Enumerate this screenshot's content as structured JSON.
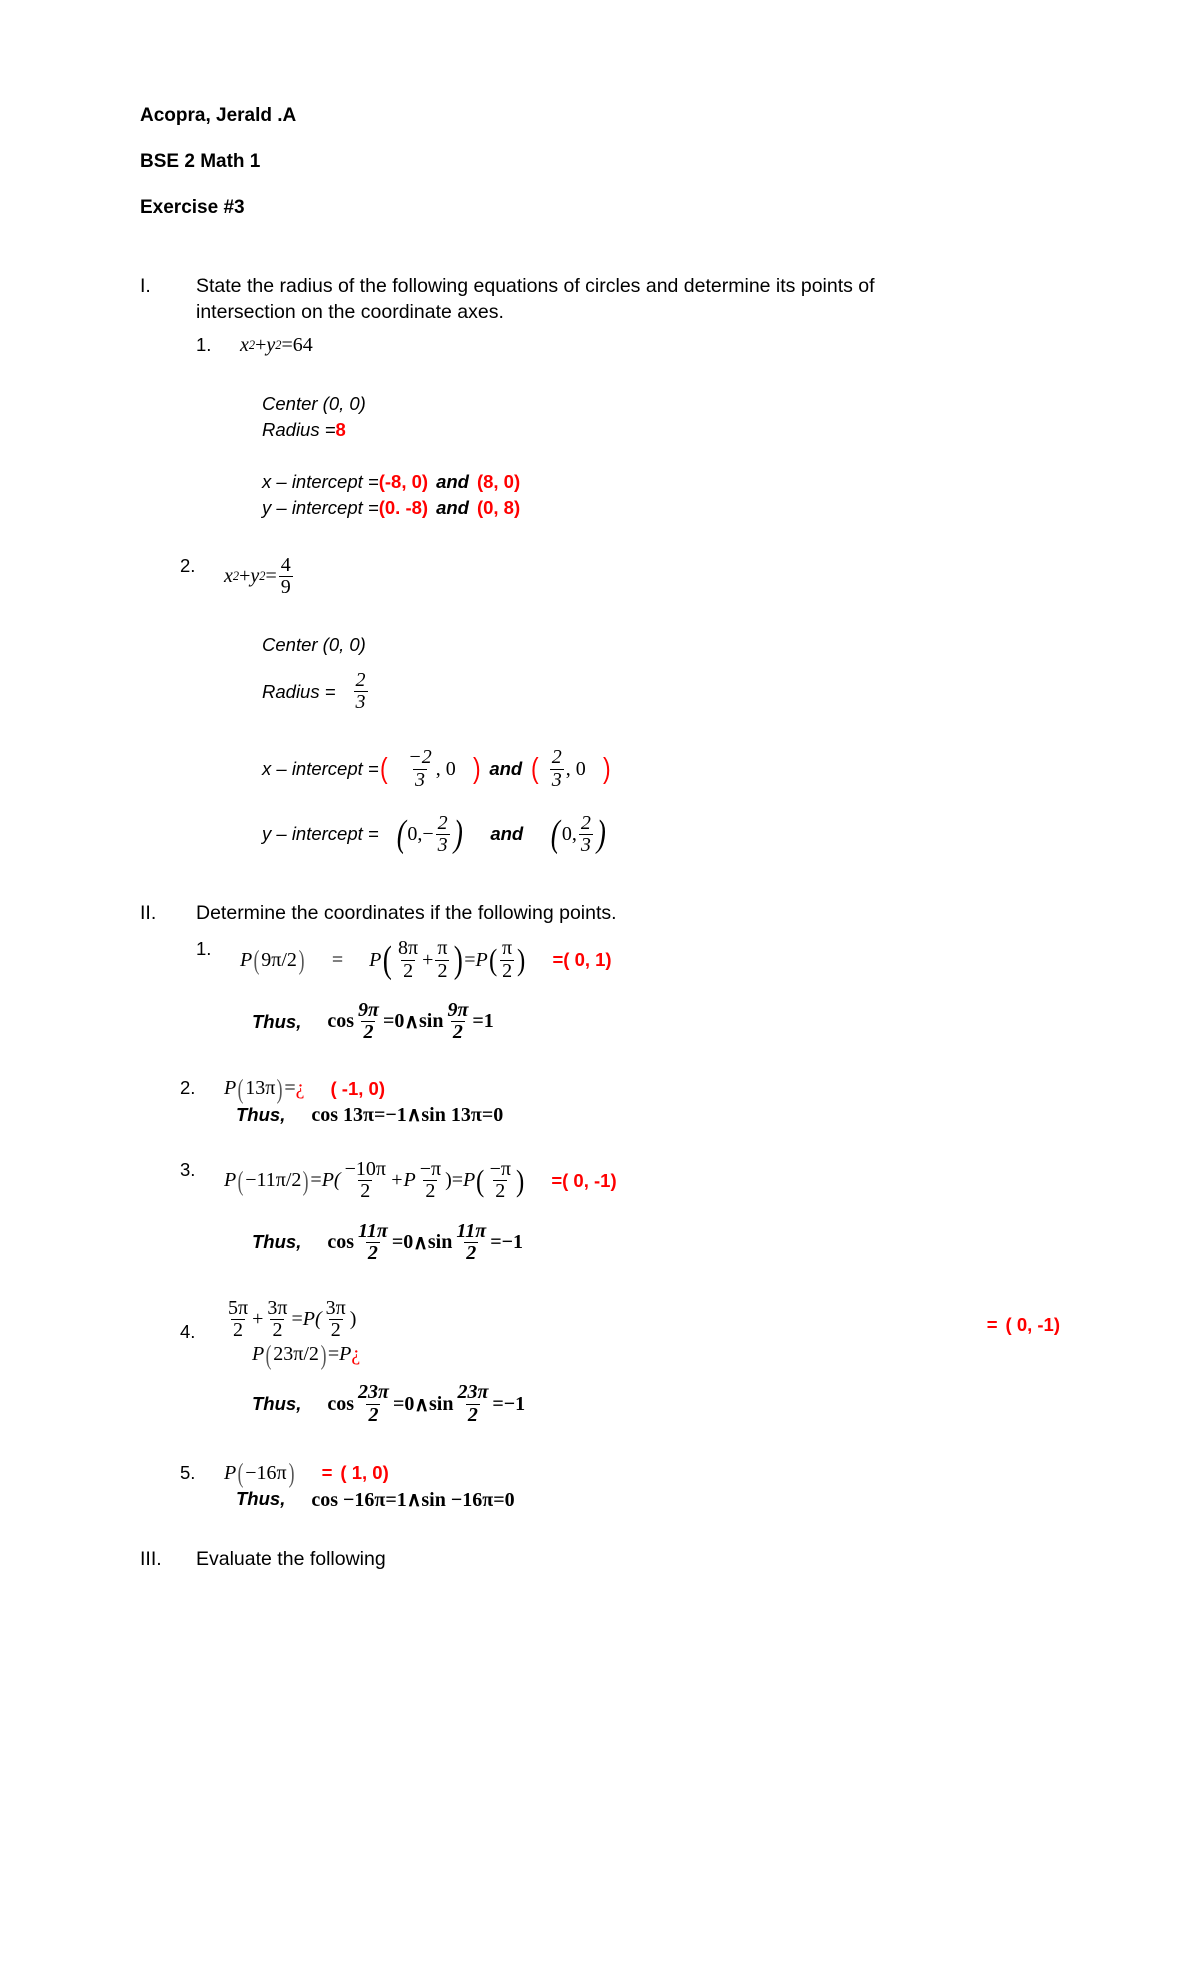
{
  "document": {
    "header": {
      "name": "Acopra, Jerald .A",
      "course": "BSE 2 Math 1",
      "exercise": "Exercise #3"
    },
    "sections": [
      {
        "numeral": "I.",
        "instruction": "State the radius of the following equations of circles and determine its points of intersection on the coordinate axes."
      },
      {
        "numeral": "II.",
        "instruction": "Determine the coordinates if the following points."
      },
      {
        "numeral": "III.",
        "instruction": "Evaluate the following"
      }
    ],
    "section1": {
      "item1": {
        "number": "1.",
        "equation": {
          "x": "x",
          "xsup": "2",
          "plus": "+",
          "y": "y",
          "ysup": "2",
          "eq": "=",
          "rhs": "64"
        },
        "center_label": "Center (0, 0)",
        "radius_label": "Radius = ",
        "radius_value": "8",
        "x_intercept_label": "x – intercept = ",
        "x_intercept_a": "(-8, 0)",
        "x_intercept_and": "and",
        "x_intercept_b": "(8, 0)",
        "y_intercept_label": "y – intercept = ",
        "y_intercept_a": "(0. -8)",
        "y_intercept_and": "and",
        "y_intercept_b": "(0, 8)"
      },
      "item2": {
        "number": "2.",
        "equation": {
          "x": "x",
          "xsup": "2",
          "plus": "+",
          "y": "y",
          "ysup": "2",
          "eq": "=",
          "rhs_num": "4",
          "rhs_den": "9"
        },
        "center_label": "Center (0, 0)",
        "radius_label": "Radius = ",
        "radius_num": "2",
        "radius_den": "3",
        "x_intercept_label": "x – intercept = ",
        "x_paren_open": "(",
        "x_a_num": "−2",
        "x_a_den": "3",
        "x_a_zero": ", 0",
        "x_paren_close": ")",
        "x_and": "and",
        "x_paren_open2": "(",
        "x_b_num": "2",
        "x_b_den": "3",
        "x_b_zero": ", 0",
        "x_paren_close2": ")",
        "y_intercept_label": "y – intercept = ",
        "y_a_open": "(",
        "y_a_zero": "0,−",
        "y_a_num": "2",
        "y_a_den": "3",
        "y_a_close": ")",
        "y_and": "and",
        "y_b_open": "(",
        "y_b_zero": "0,",
        "y_b_num": "2",
        "y_b_den": "3",
        "y_b_close": ")"
      }
    },
    "section2": {
      "item1": {
        "number": "1.",
        "p_open": "P",
        "arg": "9π/2",
        "equals1": "=",
        "p2": "P",
        "f1_num": "8π",
        "f1_den": "2",
        "plus": "+",
        "f2_num": "π",
        "f2_den": "2",
        "equals2": "=",
        "p3": "P",
        "f3_num": "π",
        "f3_den": "2",
        "answer_eq": "=",
        "answer": "( 0, 1)",
        "thus_label": "Thus,",
        "thus_cos": "cos",
        "thus_cos_num": "9π",
        "thus_cos_den": "2",
        "thus_cos_val": "=0",
        "wedge": "∧",
        "thus_sin": "sin",
        "thus_sin_num": "9π",
        "thus_sin_den": "2",
        "thus_sin_val": "=1"
      },
      "item2": {
        "number": "2.",
        "expr_p": "P",
        "expr_arg": "13π",
        "expr_eq": "=",
        "expr_q": "¿",
        "answer": "( -1, 0)",
        "thus_label": "Thus,",
        "thus": "cos 13π=−1∧sin 13π=0"
      },
      "item3": {
        "number": "3.",
        "p1": "P",
        "arg": "−11π/2",
        "eq1": "=",
        "p2": "P(",
        "f1_num": "−10π",
        "f1_den": "2",
        "plus_p": "+P",
        "f2_num": "−π",
        "f2_den": "2",
        "close1": ")",
        "eq2": "=",
        "p3": "P",
        "f3_num": "−π",
        "f3_den": "2",
        "answer_eq": "=",
        "answer": "( 0, -1)",
        "thus_label": "Thus,",
        "thus_cos": "cos",
        "thus_cos_num": "11π",
        "thus_cos_den": "2",
        "thus_cos_val": "=0",
        "wedge": "∧",
        "thus_sin": "sin",
        "thus_sin_num": "11π",
        "thus_sin_den": "2",
        "thus_sin_val": "=−1"
      },
      "item4": {
        "number": "4.",
        "l1_f1_num": "5π",
        "l1_f1_den": "2",
        "l1_plus": "+",
        "l1_f2_num": "3π",
        "l1_f2_den": "2",
        "l1_eq": "=",
        "l1_p": "P(",
        "l1_f3_num": "3π",
        "l1_f3_den": "2",
        "l1_close": ")",
        "answer_eq": "=",
        "answer": "( 0, -1)",
        "l2_p": "P",
        "l2_arg": "23π/2",
        "l2_eq": "=",
        "l2_p2": "P",
        "l2_q": "¿",
        "thus_label": "Thus,",
        "thus_cos": "cos",
        "thus_cos_num": "23π",
        "thus_cos_den": "2",
        "thus_cos_val": "=0",
        "wedge": "∧",
        "thus_sin": "sin",
        "thus_sin_num": "23π",
        "thus_sin_den": "2",
        "thus_sin_val": "=−1"
      },
      "item5": {
        "number": "5.",
        "p": "P",
        "arg": "−16π",
        "answer_eq": "=",
        "answer": "( 1, 0)",
        "thus_label": "Thus,",
        "thus": "cos −16π=1∧sin −16π=0"
      }
    },
    "colors": {
      "answer_red": "#ff0000",
      "text_black": "#000000",
      "page_background": "#ffffff"
    }
  }
}
